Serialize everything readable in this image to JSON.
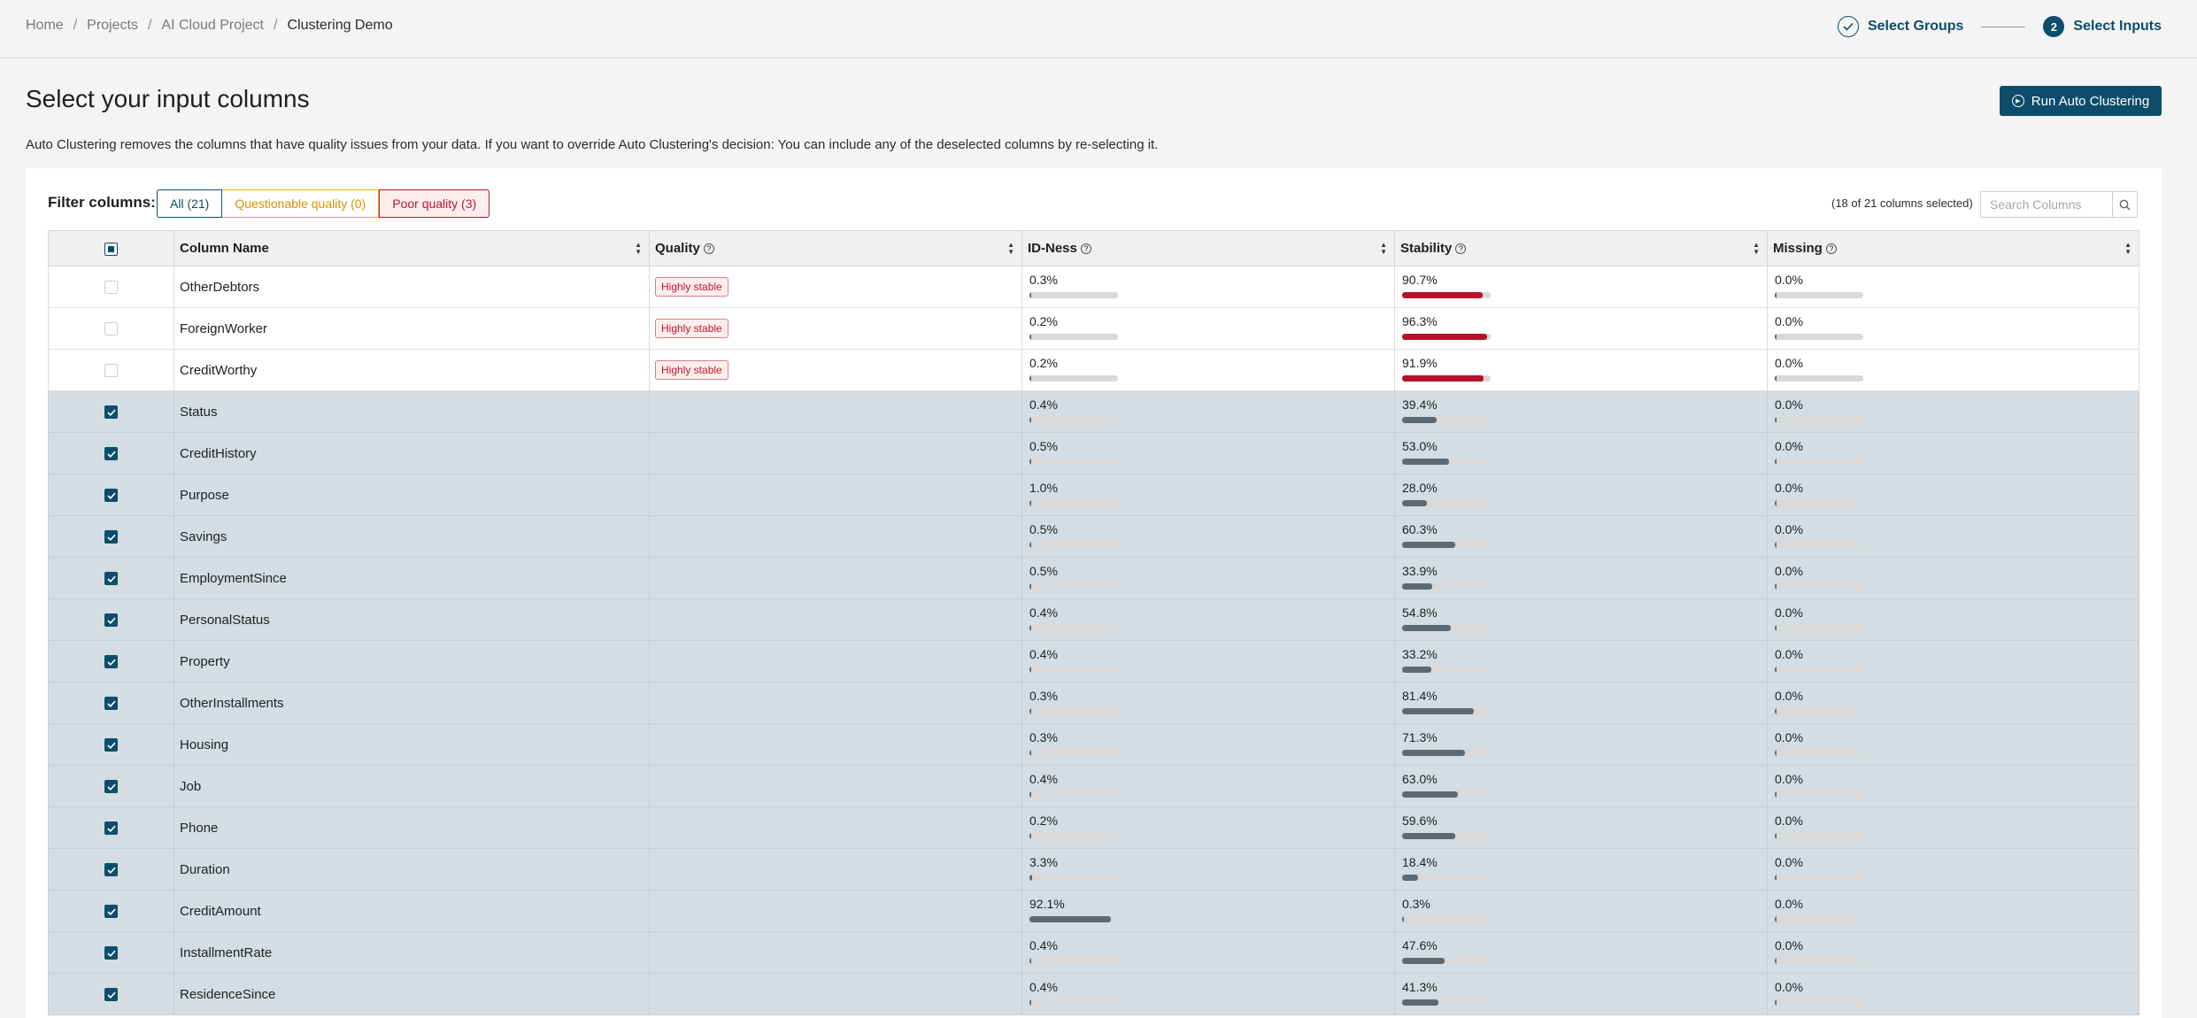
{
  "breadcrumb": [
    "Home",
    "Projects",
    "AI Cloud Project",
    "Clustering Demo"
  ],
  "steps": [
    {
      "label": "Select Groups",
      "state": "done",
      "number": ""
    },
    {
      "label": "Select Inputs",
      "state": "active",
      "number": "2"
    }
  ],
  "title": "Select your input columns",
  "run_button_label": "Run Auto Clustering",
  "description": "Auto Clustering removes the columns that have quality issues from your data. If you want to override Auto Clustering's decision: You can include any of the deselected columns by re-selecting it.",
  "filter": {
    "label": "Filter columns:",
    "chips": [
      {
        "label": "All (21)",
        "kind": "all"
      },
      {
        "label": "Questionable quality (0)",
        "kind": "q"
      },
      {
        "label": "Poor quality (3)",
        "kind": "p"
      }
    ],
    "selected_count": "(18 of 21 columns selected)",
    "search_placeholder": "Search Columns"
  },
  "colors": {
    "accent": "#0d4d6b",
    "poor": "#c2142d",
    "questionable": "#f0b400",
    "bar_default": "#5e6a73"
  },
  "table": {
    "headers": {
      "name": "Column Name",
      "quality": "Quality",
      "idness": "ID-Ness",
      "stability": "Stability",
      "missing": "Missing"
    },
    "rows": [
      {
        "checked": false,
        "name": "OtherDebtors",
        "quality": "Highly stable",
        "idness": "0.3%",
        "stability": "90.7%",
        "missing": "0.0%",
        "stability_flag": true
      },
      {
        "checked": false,
        "name": "ForeignWorker",
        "quality": "Highly stable",
        "idness": "0.2%",
        "stability": "96.3%",
        "missing": "0.0%",
        "stability_flag": true
      },
      {
        "checked": false,
        "name": "CreditWorthy",
        "quality": "Highly stable",
        "idness": "0.2%",
        "stability": "91.9%",
        "missing": "0.0%",
        "stability_flag": true
      },
      {
        "checked": true,
        "name": "Status",
        "quality": "",
        "idness": "0.4%",
        "stability": "39.4%",
        "missing": "0.0%",
        "stability_flag": false
      },
      {
        "checked": true,
        "name": "CreditHistory",
        "quality": "",
        "idness": "0.5%",
        "stability": "53.0%",
        "missing": "0.0%",
        "stability_flag": false
      },
      {
        "checked": true,
        "name": "Purpose",
        "quality": "",
        "idness": "1.0%",
        "stability": "28.0%",
        "missing": "0.0%",
        "stability_flag": false
      },
      {
        "checked": true,
        "name": "Savings",
        "quality": "",
        "idness": "0.5%",
        "stability": "60.3%",
        "missing": "0.0%",
        "stability_flag": false
      },
      {
        "checked": true,
        "name": "EmploymentSince",
        "quality": "",
        "idness": "0.5%",
        "stability": "33.9%",
        "missing": "0.0%",
        "stability_flag": false
      },
      {
        "checked": true,
        "name": "PersonalStatus",
        "quality": "",
        "idness": "0.4%",
        "stability": "54.8%",
        "missing": "0.0%",
        "stability_flag": false
      },
      {
        "checked": true,
        "name": "Property",
        "quality": "",
        "idness": "0.4%",
        "stability": "33.2%",
        "missing": "0.0%",
        "stability_flag": false
      },
      {
        "checked": true,
        "name": "OtherInstallments",
        "quality": "",
        "idness": "0.3%",
        "stability": "81.4%",
        "missing": "0.0%",
        "stability_flag": false
      },
      {
        "checked": true,
        "name": "Housing",
        "quality": "",
        "idness": "0.3%",
        "stability": "71.3%",
        "missing": "0.0%",
        "stability_flag": false
      },
      {
        "checked": true,
        "name": "Job",
        "quality": "",
        "idness": "0.4%",
        "stability": "63.0%",
        "missing": "0.0%",
        "stability_flag": false
      },
      {
        "checked": true,
        "name": "Phone",
        "quality": "",
        "idness": "0.2%",
        "stability": "59.6%",
        "missing": "0.0%",
        "stability_flag": false
      },
      {
        "checked": true,
        "name": "Duration",
        "quality": "",
        "idness": "3.3%",
        "stability": "18.4%",
        "missing": "0.0%",
        "stability_flag": false
      },
      {
        "checked": true,
        "name": "CreditAmount",
        "quality": "",
        "idness": "92.1%",
        "stability": "0.3%",
        "missing": "0.0%",
        "stability_flag": false
      },
      {
        "checked": true,
        "name": "InstallmentRate",
        "quality": "",
        "idness": "0.4%",
        "stability": "47.6%",
        "missing": "0.0%",
        "stability_flag": false
      },
      {
        "checked": true,
        "name": "ResidenceSince",
        "quality": "",
        "idness": "0.4%",
        "stability": "41.3%",
        "missing": "0.0%",
        "stability_flag": false
      }
    ]
  }
}
